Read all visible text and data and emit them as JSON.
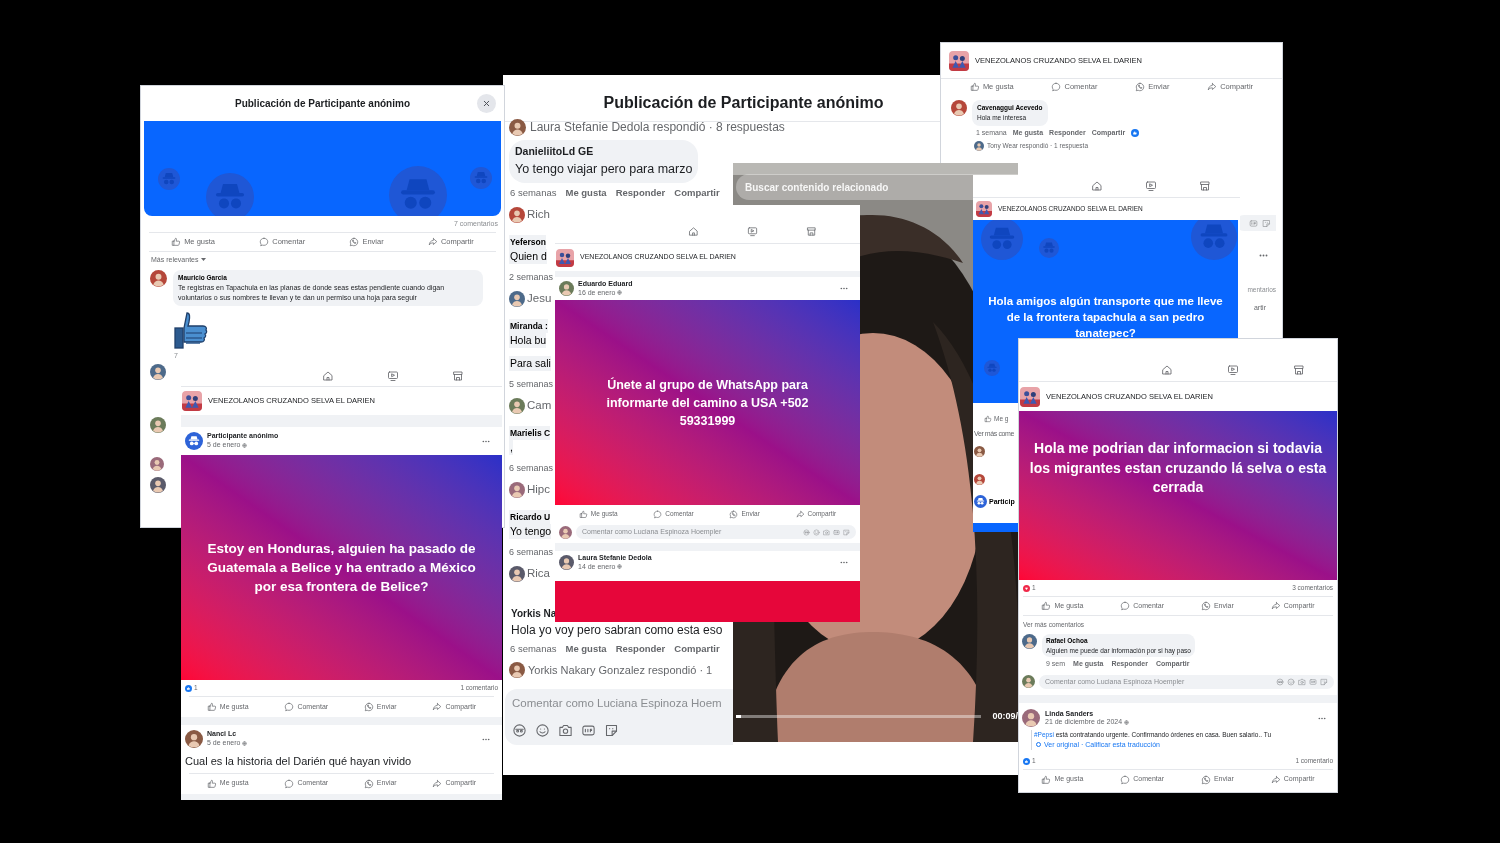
{
  "thread_window": {
    "title": "Publicación de Participante anónimo",
    "reply_summary": "Laura Stefanie Dedola respondió · 8 respuestas",
    "first_comment": {
      "author": "DanieliitoLd GE",
      "text": "Yo tengo viajar pero para marzo",
      "meta": [
        "6 semanas",
        "Me gusta",
        "Responder",
        "Compartir"
      ]
    },
    "partial_lines": [
      {
        "kind": "avatar",
        "text": "Rich"
      },
      {
        "kind": "author",
        "text": "Yeferson"
      },
      {
        "kind": "text",
        "text": "Quien d"
      },
      {
        "kind": "meta",
        "text": "2 semanas"
      },
      {
        "kind": "avatar",
        "text": "Jesu"
      },
      {
        "kind": "author",
        "text": "Miranda :"
      },
      {
        "kind": "text",
        "text": "Hola bu"
      },
      {
        "kind": "text",
        "text": "Para sali"
      },
      {
        "kind": "meta",
        "text": "5 semanas"
      },
      {
        "kind": "avatar",
        "text": "Cam"
      },
      {
        "kind": "author",
        "text": "Marielis C"
      },
      {
        "kind": "text",
        "text": ","
      },
      {
        "kind": "meta",
        "text": "6 semanas"
      },
      {
        "kind": "avatar",
        "text": "Hipc"
      },
      {
        "kind": "author",
        "text": "Ricardo U"
      },
      {
        "kind": "text",
        "text": "Yo tengo"
      },
      {
        "kind": "meta",
        "text": "6 semanas"
      },
      {
        "kind": "avatar",
        "text": "Rica"
      }
    ],
    "last_comment": {
      "author": "Yorkis Na",
      "text": "Hola yo voy pero sabran como esta eso",
      "meta": [
        "6 semanas",
        "Me gusta",
        "Responder",
        "Compartir"
      ]
    },
    "reply_summary_2": "Yorkis Nakary Gonzalez respondió · 1",
    "composer": {
      "placeholder": "Comentar como Luciana Espinoza Hoem"
    }
  },
  "anon_post_window": {
    "title": "Publicación de Participante anónimo",
    "comment_count": "7 comentarios",
    "actions": [
      "Me gusta",
      "Comentar",
      "Enviar",
      "Compartir"
    ],
    "sort": "Más relevantes",
    "comment": {
      "author": "Mauricio Garcia",
      "text": "Te registras en Tapachula en las planas de donde seas estas pendiente cuando digan voluntarios o sus nombres te llevan y te dan un permiso una hoja para seguir"
    },
    "sticker_meta": "7"
  },
  "group_feed_left": {
    "group": "VENEZOLANOS CRUZANDO SELVA EL DARIEN",
    "posts": [
      {
        "kind": "anonymous",
        "author": "Participante anónimo",
        "date": "5 de enero",
        "image": {
          "text": "Estoy en Honduras, alguien ha pasado de Guatemala a Belice y ha entrado a México por esa frontera de Belice?"
        },
        "reaction": {
          "kind": "like",
          "count": "1"
        },
        "comment_count": "1 comentario",
        "actions": [
          "Me gusta",
          "Comentar",
          "Enviar",
          "Compartir"
        ]
      },
      {
        "author": "Nanci Lc",
        "date": "5 de enero",
        "text": "Cual es la historia del Darién qué hayan vivido",
        "actions": [
          "Me gusta",
          "Comentar",
          "Enviar",
          "Compartir"
        ]
      }
    ]
  },
  "group_feed_top_right": {
    "group": "VENEZOLANOS CRUZANDO SELVA EL DARIEN",
    "actions": [
      "Me gusta",
      "Comentar",
      "Enviar",
      "Compartir"
    ],
    "comment": {
      "author": "Cavenaggui Acevedo",
      "text": "Hola me interesa",
      "meta": [
        "1 semana",
        "Me gusta",
        "Responder",
        "Compartir"
      ]
    },
    "reply_summary": "Tony Wear respondió · 1 respuesta",
    "fragments": {
      "comment_count": "mentarios",
      "action": "artir"
    }
  },
  "video": {
    "search_placeholder": "Buscar contenido relacionado",
    "progress": {
      "level": 0.02
    },
    "time": "00:09/"
  },
  "group_feed_center": {
    "group": "VENEZOLANOS CRUZANDO SELVA EL DARIEN",
    "posts": [
      {
        "author": "Eduardo Eduard",
        "date": "16 de enero",
        "image": {
          "text": "Únete al grupo de WhatsApp para informarte del camino a USA +502 59331999"
        },
        "actions": [
          "Me gusta",
          "Comentar",
          "Enviar",
          "Compartir"
        ],
        "composer": "Comentar como Luciana Espinoza Hoempler"
      },
      {
        "author": "Laura Stefanie Dedola",
        "date": "14 de enero"
      }
    ]
  },
  "group_feed_blue": {
    "group": "VENEZOLANOS CRUZANDO SELVA EL DARIEN",
    "image": {
      "text": "Hola amigos algún transporte que me lleve de la frontera tapachula a san pedro tanatepec?"
    },
    "fragments": {
      "action": "Me g",
      "more_comments": "Ver más come",
      "author": "Particip"
    }
  },
  "group_feed_right": {
    "group": "VENEZOLANOS CRUZANDO SELVA EL DARIEN",
    "post": {
      "image": {
        "text": "Hola me podrian dar informacion si todavia los migrantes estan cruzando lá selva o esta cerrada"
      },
      "reaction": {
        "kind": "love",
        "count": "1"
      },
      "comment_count": "3 comentarios",
      "actions": [
        "Me gusta",
        "Comentar",
        "Enviar",
        "Compartir"
      ],
      "more_comments": "Ver más comentarios",
      "comment": {
        "author": "Rafael Ochoa",
        "text": "Alguien me puede dar información por si hay paso",
        "meta": [
          "9 sem",
          "Me gusta",
          "Responder",
          "Compartir"
        ]
      },
      "composer": "Comentar como Luciana Espinoza Hoempler"
    },
    "post2": {
      "author": "Linda Sanders",
      "date": "21 de diciembre de 2024",
      "hashtag": "#Pepsi",
      "text": "está contratando urgente. Confirmando órdenes en casa. Buen salario.. Tu",
      "translation": "Ver original · Calificar esta traducción",
      "reaction": {
        "kind": "like",
        "count": "1"
      },
      "comment_count": "1 comentario",
      "actions": [
        "Me gusta",
        "Comentar",
        "Enviar",
        "Compartir"
      ]
    }
  }
}
